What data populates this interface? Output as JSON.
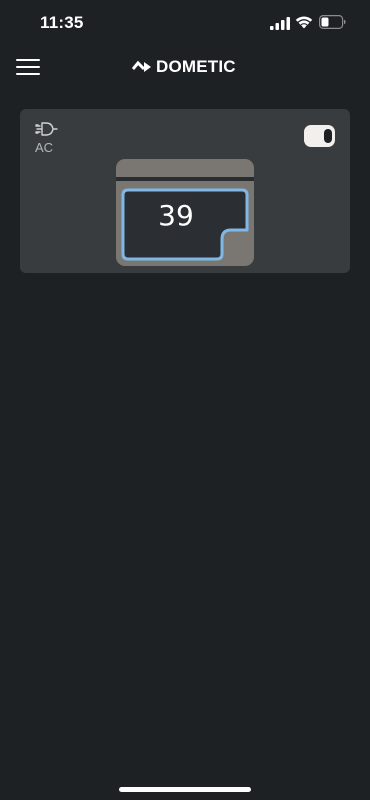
{
  "status_bar": {
    "time": "11:35",
    "icons": [
      "cellular-signal-icon",
      "wifi-icon",
      "battery-icon"
    ]
  },
  "header": {
    "menu_icon": "hamburger-menu-icon",
    "brand": "DOMETIC"
  },
  "device": {
    "power_source": "AC",
    "power_source_icon": "plug-icon",
    "power_on": true,
    "compartment_temperature": "39"
  },
  "colors": {
    "background": "#1e2124",
    "card": "#393c3f",
    "fridge_body": "#7a7773",
    "compartment_outline": "#7fb8e6",
    "toggle": "#f2efec"
  }
}
